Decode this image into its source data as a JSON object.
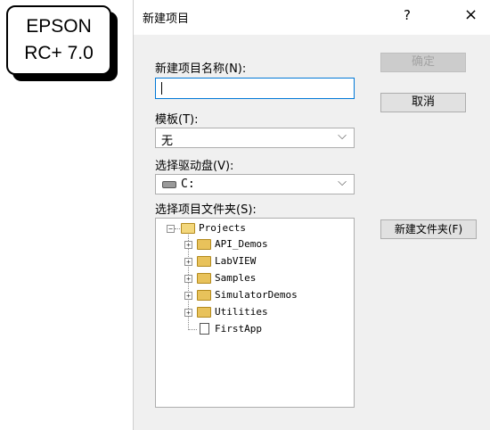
{
  "badge": {
    "line1": "EPSON",
    "line2": "RC+ 7.0"
  },
  "dialog": {
    "title": "新建项目",
    "help": "?",
    "close": "×",
    "name_label": "新建项目名称(N):",
    "name_value": "",
    "template_label": "模板(T):",
    "template_value": "无",
    "drive_label": "选择驱动盘(V):",
    "drive_value": "C:",
    "folder_label": "选择项目文件夹(S):",
    "ok_button": "确定",
    "cancel_button": "取消",
    "new_folder_button": "新建文件夹(F)"
  },
  "tree": {
    "root": "Projects",
    "children": [
      "API_Demos",
      "LabVIEW",
      "Samples",
      "SimulatorDemos",
      "Utilities"
    ],
    "file": "FirstApp"
  }
}
